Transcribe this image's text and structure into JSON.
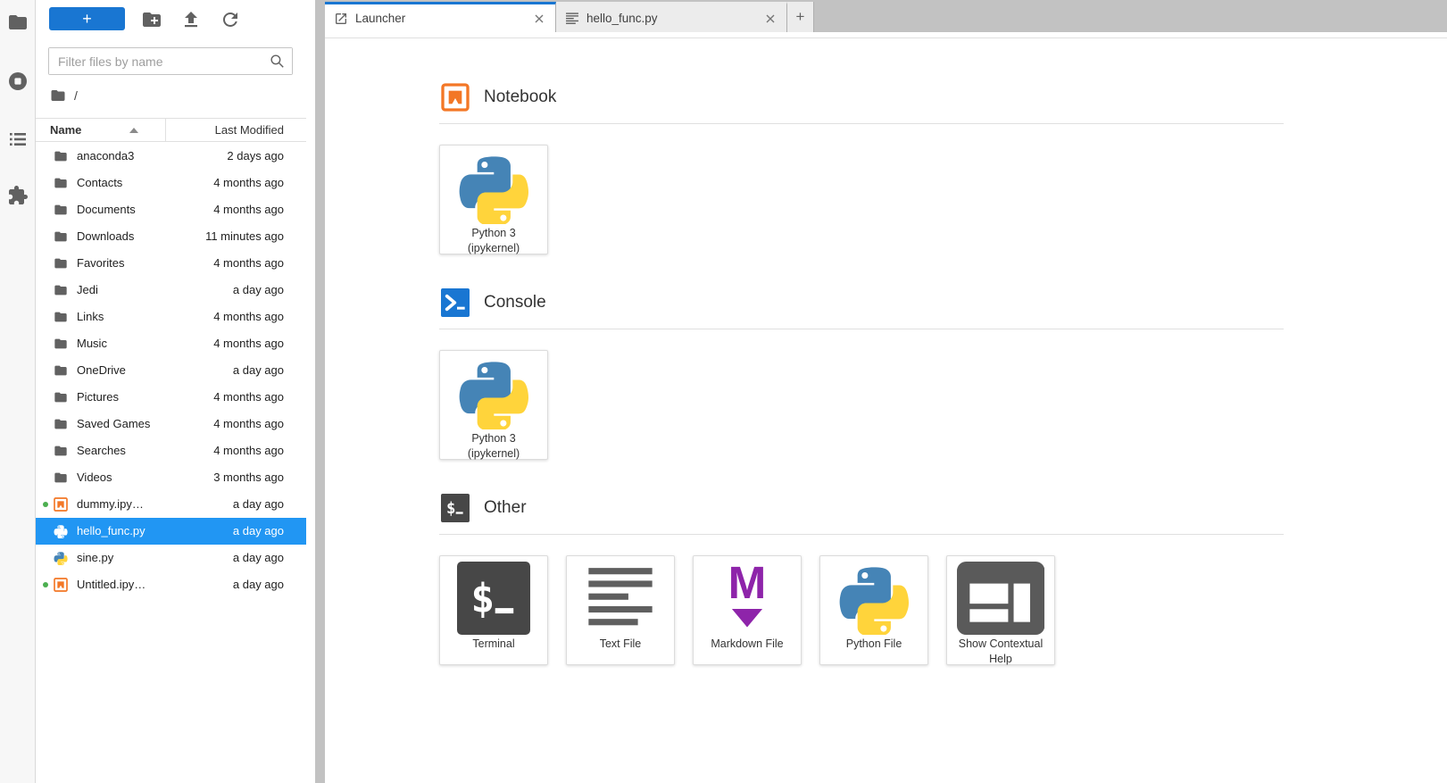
{
  "activity_bar": {
    "items": [
      {
        "id": "file-browser",
        "icon": "folder"
      },
      {
        "id": "running-sessions",
        "icon": "stop-circle"
      },
      {
        "id": "table-of-contents",
        "icon": "toc-list"
      },
      {
        "id": "extensions",
        "icon": "puzzle"
      }
    ]
  },
  "file_browser": {
    "toolbar": {
      "new_launcher_label": "+",
      "buttons": [
        "new-folder",
        "upload",
        "refresh"
      ]
    },
    "filter_placeholder": "Filter files by name",
    "breadcrumb_root": "/",
    "header": {
      "name": "Name",
      "last_modified": "Last Modified",
      "sort_direction": "ascending"
    },
    "rows": [
      {
        "name": "anaconda3",
        "modified": "2 days ago",
        "icon": "folder"
      },
      {
        "name": "Contacts",
        "modified": "4 months ago",
        "icon": "folder"
      },
      {
        "name": "Documents",
        "modified": "4 months ago",
        "icon": "folder"
      },
      {
        "name": "Downloads",
        "modified": "11 minutes ago",
        "icon": "folder"
      },
      {
        "name": "Favorites",
        "modified": "4 months ago",
        "icon": "folder"
      },
      {
        "name": "Jedi",
        "modified": "a day ago",
        "icon": "folder"
      },
      {
        "name": "Links",
        "modified": "4 months ago",
        "icon": "folder"
      },
      {
        "name": "Music",
        "modified": "4 months ago",
        "icon": "folder"
      },
      {
        "name": "OneDrive",
        "modified": "a day ago",
        "icon": "folder"
      },
      {
        "name": "Pictures",
        "modified": "4 months ago",
        "icon": "folder"
      },
      {
        "name": "Saved Games",
        "modified": "4 months ago",
        "icon": "folder"
      },
      {
        "name": "Searches",
        "modified": "4 months ago",
        "icon": "folder"
      },
      {
        "name": "Videos",
        "modified": "3 months ago",
        "icon": "folder"
      },
      {
        "name": "dummy.ipy…",
        "modified": "a day ago",
        "icon": "notebook",
        "running": true
      },
      {
        "name": "hello_func.py",
        "modified": "a day ago",
        "icon": "python",
        "selected": true
      },
      {
        "name": "sine.py",
        "modified": "a day ago",
        "icon": "python"
      },
      {
        "name": "Untitled.ipy…",
        "modified": "a day ago",
        "icon": "notebook",
        "running": true
      }
    ]
  },
  "tab_bar": {
    "tabs": [
      {
        "label": "Launcher",
        "icon": "launcher",
        "active": true
      },
      {
        "label": "hello_func.py",
        "icon": "text-file",
        "active": false
      }
    ],
    "add_label": "+"
  },
  "launcher": {
    "sections": [
      {
        "title": "Notebook",
        "icon": "notebook",
        "cards": [
          {
            "label": "Python 3 (ipykernel)",
            "icon": "python"
          }
        ]
      },
      {
        "title": "Console",
        "icon": "console",
        "cards": [
          {
            "label": "Python 3 (ipykernel)",
            "icon": "python"
          }
        ]
      },
      {
        "title": "Other",
        "icon": "terminal",
        "cards": [
          {
            "label": "Terminal",
            "icon": "terminal"
          },
          {
            "label": "Text File",
            "icon": "text-file"
          },
          {
            "label": "Markdown File",
            "icon": "markdown"
          },
          {
            "label": "Python File",
            "icon": "python"
          },
          {
            "label": "Show Contextual Help",
            "icon": "contextual-help"
          }
        ]
      }
    ]
  },
  "colors": {
    "accent_blue": "#1976d2",
    "selection_blue": "#2196f3",
    "notebook_orange": "#f37726",
    "markdown_purple": "#8e24aa",
    "python_blue": "#4584b6",
    "python_yellow": "#ffd43b",
    "running_green": "#4caf50",
    "icon_gray": "#616161"
  }
}
